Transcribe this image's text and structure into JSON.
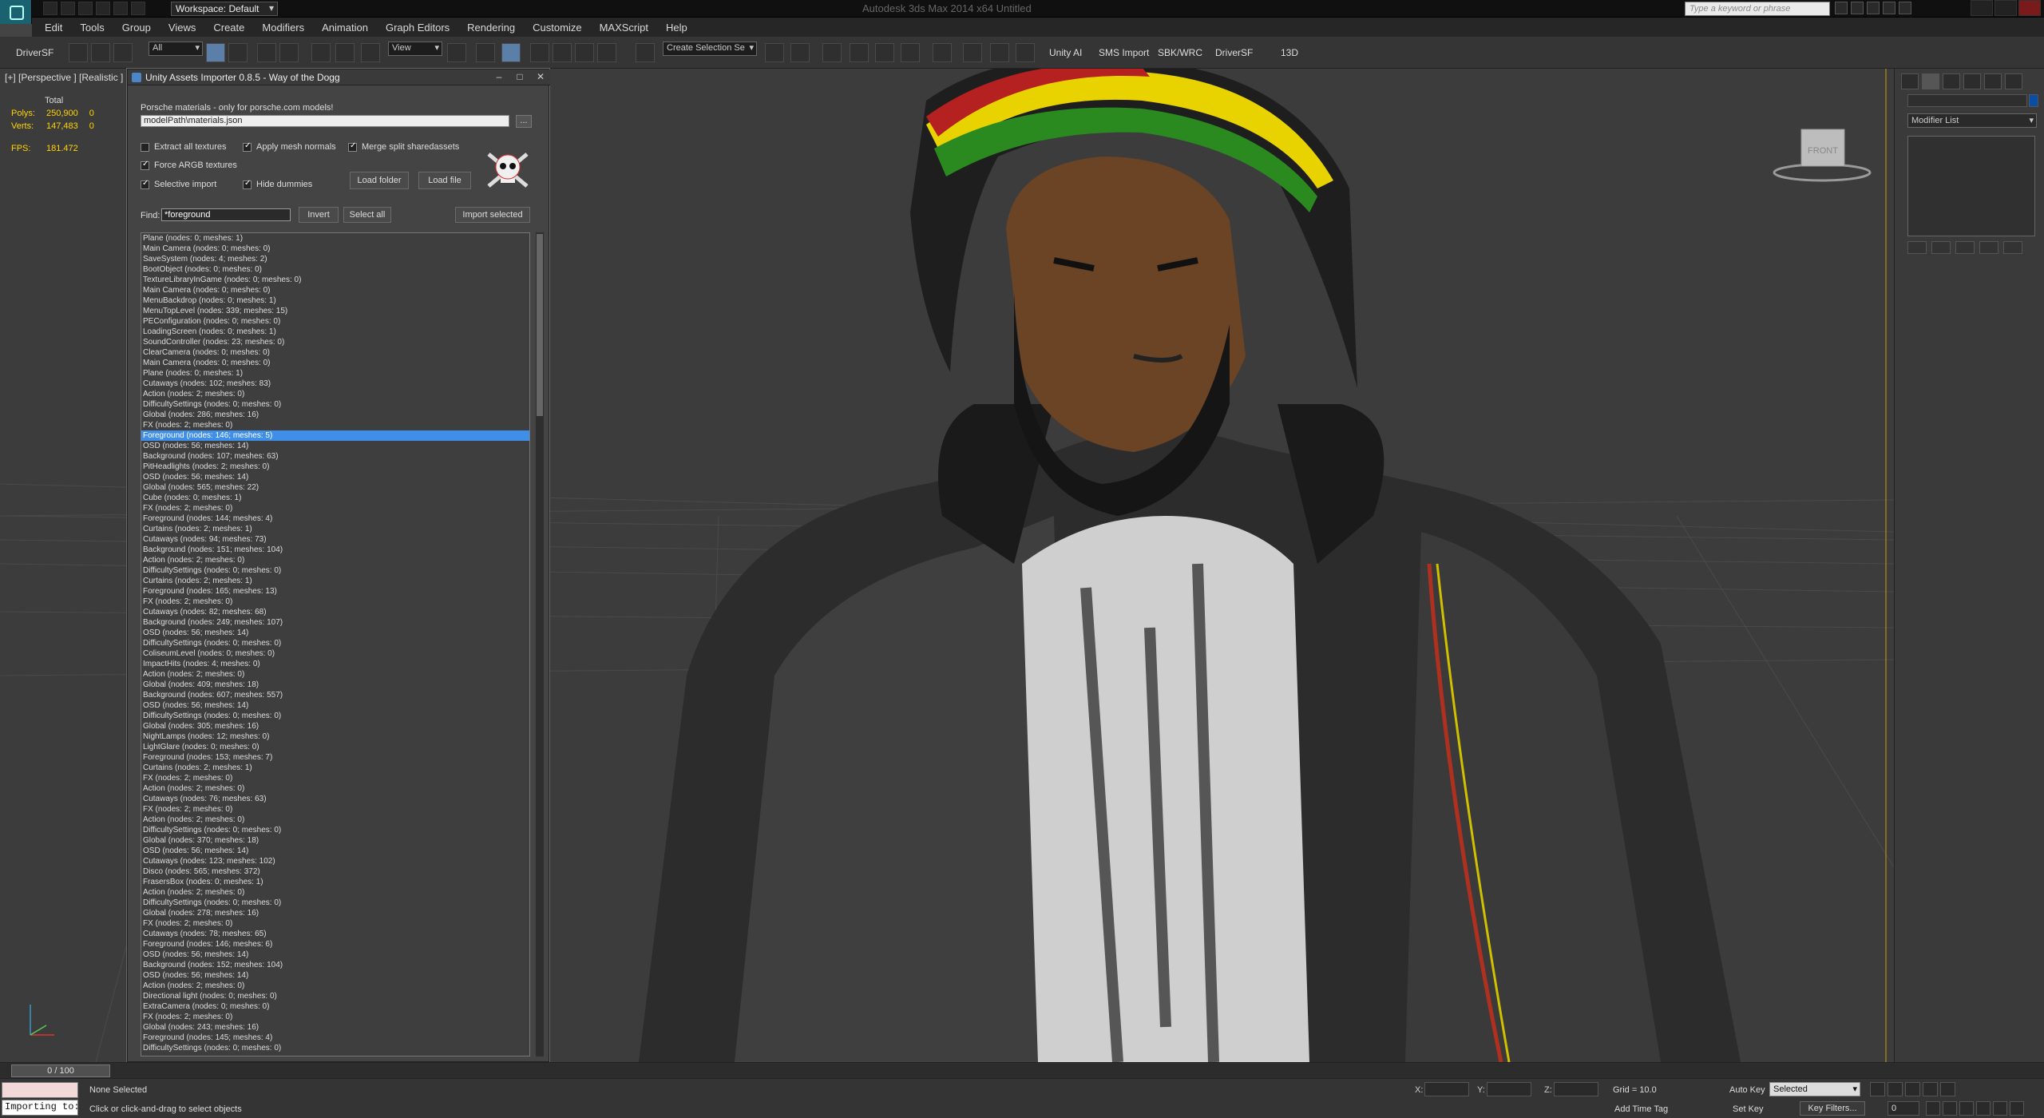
{
  "app": {
    "title": "Autodesk 3ds Max 2014 x64    Untitled",
    "workspace": "Workspace: Default",
    "search_placeholder": "Type a keyword or phrase"
  },
  "menu": [
    "Edit",
    "Tools",
    "Group",
    "Views",
    "Create",
    "Modifiers",
    "Animation",
    "Graph Editors",
    "Rendering",
    "Customize",
    "MAXScript",
    "Help"
  ],
  "toolbar": {
    "driver_left": "DriverSF",
    "filter": "All",
    "refcoord": "View",
    "selection_set": "Create Selection Se",
    "extras": [
      "Unity AI",
      "SMS Import",
      "SBK/WRC",
      "DriverSF",
      "13D"
    ]
  },
  "viewport": {
    "label": "[+] [Perspective ] [Realistic ]",
    "stats": {
      "header": "Total",
      "polys_label": "Polys:",
      "polys_total": "250,900",
      "polys_sel": "0",
      "verts_label": "Verts:",
      "verts_total": "147,483",
      "verts_sel": "0",
      "fps_label": "FPS:",
      "fps": "181.472"
    },
    "viewcube_label": "FRONT"
  },
  "dialog": {
    "title": "Unity Assets Importer 0.8.5 - Way of the Dogg",
    "note": "Porsche materials - only for porsche.com models!",
    "path": "modelPath\\materials.json",
    "browse": "...",
    "options": {
      "extract": {
        "label": "Extract all textures",
        "checked": false
      },
      "normals": {
        "label": "Apply mesh normals",
        "checked": true
      },
      "merge": {
        "label": "Merge split sharedassets",
        "checked": true
      },
      "argb": {
        "label": "Force ARGB textures",
        "checked": true
      },
      "selective": {
        "label": "Selective import",
        "checked": true
      },
      "dummies": {
        "label": "Hide dummies",
        "checked": true
      }
    },
    "load_folder": "Load folder",
    "load_file": "Load file",
    "find_label": "Find:",
    "find_value": "*foreground",
    "invert": "Invert",
    "select_all": "Select all",
    "import_selected": "Import selected",
    "selected_index": 19,
    "items": [
      "Plane (nodes: 0; meshes: 1)",
      "Main Camera (nodes: 0; meshes: 0)",
      "SaveSystem (nodes: 4; meshes: 2)",
      "BootObject (nodes: 0; meshes: 0)",
      "TextureLibraryInGame (nodes: 0; meshes: 0)",
      "Main Camera (nodes: 0; meshes: 0)",
      "MenuBackdrop (nodes: 0; meshes: 1)",
      "MenuTopLevel (nodes: 339; meshes: 15)",
      "PEConfiguration (nodes: 0; meshes: 0)",
      "LoadingScreen (nodes: 0; meshes: 1)",
      "SoundController (nodes: 23; meshes: 0)",
      "ClearCamera (nodes: 0; meshes: 0)",
      "Main Camera (nodes: 0; meshes: 0)",
      "Plane (nodes: 0; meshes: 1)",
      "Cutaways (nodes: 102; meshes: 83)",
      "Action (nodes: 2; meshes: 0)",
      "DifficultySettings (nodes: 0; meshes: 0)",
      "Global (nodes: 286; meshes: 16)",
      "FX (nodes: 2; meshes: 0)",
      "Foreground (nodes: 146; meshes: 5)",
      "OSD (nodes: 56; meshes: 14)",
      "Background (nodes: 107; meshes: 63)",
      "PitHeadlights (nodes: 2; meshes: 0)",
      "OSD (nodes: 56; meshes: 14)",
      "Global (nodes: 565; meshes: 22)",
      "Cube (nodes: 0; meshes: 1)",
      "FX (nodes: 2; meshes: 0)",
      "Foreground (nodes: 144; meshes: 4)",
      "Curtains (nodes: 2; meshes: 1)",
      "Cutaways (nodes: 94; meshes: 73)",
      "Background (nodes: 151; meshes: 104)",
      "Action (nodes: 2; meshes: 0)",
      "DifficultySettings (nodes: 0; meshes: 0)",
      "Curtains (nodes: 2; meshes: 1)",
      "Foreground (nodes: 165; meshes: 13)",
      "FX (nodes: 2; meshes: 0)",
      "Cutaways (nodes: 82; meshes: 68)",
      "Background (nodes: 249; meshes: 107)",
      "OSD (nodes: 56; meshes: 14)",
      "DifficultySettings (nodes: 0; meshes: 0)",
      "ColiseumLevel (nodes: 0; meshes: 0)",
      "ImpactHits (nodes: 4; meshes: 0)",
      "Action (nodes: 2; meshes: 0)",
      "Global (nodes: 409; meshes: 18)",
      "Background (nodes: 607; meshes: 557)",
      "OSD (nodes: 56; meshes: 14)",
      "DifficultySettings (nodes: 0; meshes: 0)",
      "Global (nodes: 305; meshes: 16)",
      "NightLamps (nodes: 12; meshes: 0)",
      "LightGlare (nodes: 0; meshes: 0)",
      "Foreground (nodes: 153; meshes: 7)",
      "Curtains (nodes: 2; meshes: 1)",
      "FX (nodes: 2; meshes: 0)",
      "Action (nodes: 2; meshes: 0)",
      "Cutaways (nodes: 76; meshes: 63)",
      "FX (nodes: 2; meshes: 0)",
      "Action (nodes: 2; meshes: 0)",
      "DifficultySettings (nodes: 0; meshes: 0)",
      "Global (nodes: 370; meshes: 18)",
      "OSD (nodes: 56; meshes: 14)",
      "Cutaways (nodes: 123; meshes: 102)",
      "Disco (nodes: 565; meshes: 372)",
      "FrasersBox (nodes: 0; meshes: 1)",
      "Action (nodes: 2; meshes: 0)",
      "DifficultySettings (nodes: 0; meshes: 0)",
      "Global (nodes: 278; meshes: 16)",
      "FX (nodes: 2; meshes: 0)",
      "Cutaways (nodes: 78; meshes: 65)",
      "Foreground (nodes: 146; meshes: 6)",
      "OSD (nodes: 56; meshes: 14)",
      "Background (nodes: 152; meshes: 104)",
      "OSD (nodes: 56; meshes: 14)",
      "Action (nodes: 2; meshes: 0)",
      "Directional light (nodes: 0; meshes: 0)",
      "ExtraCamera (nodes: 0; meshes: 0)",
      "FX (nodes: 2; meshes: 0)",
      "Global (nodes: 243; meshes: 16)",
      "Foreground (nodes: 145; meshes: 4)",
      "DifficultySettings (nodes: 0; meshes: 0)"
    ]
  },
  "command_panel": {
    "modifier_list": "Modifier List"
  },
  "status": {
    "time": "0 / 100",
    "selection": "None Selected",
    "hint": "Click or click-and-drag to select objects",
    "listener": "Importing to:",
    "x": "X:",
    "y": "Y:",
    "z": "Z:",
    "grid": "Grid = 10.0",
    "add_time_tag": "Add Time Tag",
    "auto_key": "Auto Key",
    "set_key": "Set Key",
    "key_mode": "Selected",
    "key_filters": "Key Filters...",
    "frame": "0"
  }
}
